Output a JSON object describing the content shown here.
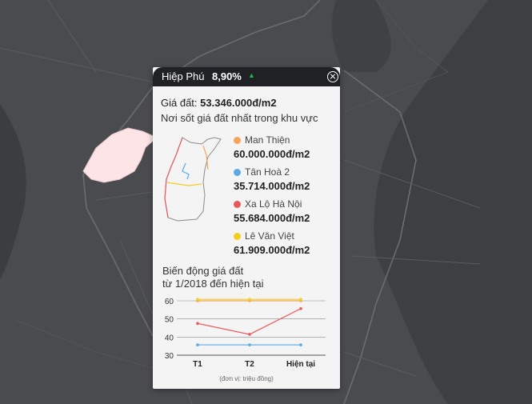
{
  "popup": {
    "district": "Hiệp Phú",
    "change": "8,90%",
    "trend_icon": "▲",
    "price_label": "Giá đất:",
    "price_value": "53.346.000đ/m2",
    "hot_title": "Nơi sốt giá đất nhất trong khu vực"
  },
  "streets": [
    {
      "name": "Man Thiện",
      "value": "60.000.000đ/m2",
      "color": "#f4a358"
    },
    {
      "name": "Tân Hoà 2",
      "value": "35.714.000đ/m2",
      "color": "#5aa9e6"
    },
    {
      "name": "Xa Lộ Hà Nội",
      "value": "55.684.000đ/m2",
      "color": "#e8585c"
    },
    {
      "name": "Lê Văn Việt",
      "value": "61.909.000đ/m2",
      "color": "#f2cf1d"
    }
  ],
  "chart_title": "Biến động giá đất\ntừ 1/2018 đến hiện tại",
  "chart_data": {
    "type": "line",
    "categories": [
      "T1",
      "T2",
      "Hiện tại"
    ],
    "ylim": [
      30,
      60
    ],
    "yticks": [
      30,
      40,
      50,
      60
    ],
    "unit_note": "(đơn vị: triệu đồng)",
    "grid": true,
    "series": [
      {
        "name": "Man Thiện",
        "color": "#f4a358",
        "values": [
          60,
          60,
          60
        ]
      },
      {
        "name": "Tân Hoà 2",
        "color": "#5aa9e6",
        "values": [
          35.7,
          35.7,
          35.7
        ]
      },
      {
        "name": "Xa Lộ Hà Nội",
        "color": "#e8585c",
        "values": [
          47.5,
          41.5,
          55.7
        ]
      },
      {
        "name": "Lê Văn Việt",
        "color": "#f2cf1d",
        "values": [
          60.8,
          60.8,
          60.8
        ]
      }
    ]
  },
  "colors": {
    "map_bg": "#4a4b4f",
    "header_bg": "#202125",
    "trend_up": "#22b24c",
    "highlight": "#fde4e6"
  }
}
